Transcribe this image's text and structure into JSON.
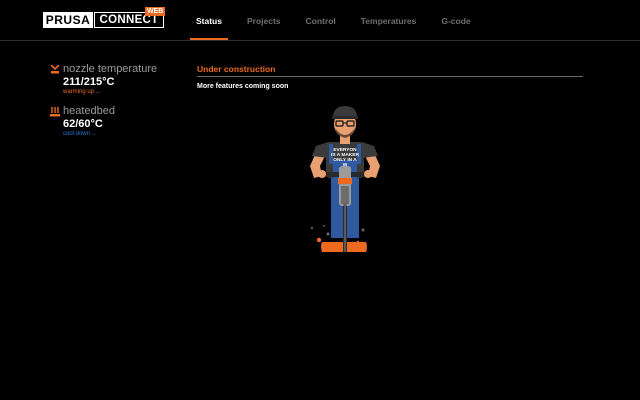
{
  "header": {
    "logo": {
      "brand": "PRUSA",
      "product": "CONNECT",
      "badge": "WEB"
    },
    "tabs": [
      {
        "label": "Status",
        "active": true
      },
      {
        "label": "Projects",
        "active": false
      },
      {
        "label": "Control",
        "active": false
      },
      {
        "label": "Temperatures",
        "active": false
      },
      {
        "label": "G-code",
        "active": false
      }
    ]
  },
  "sidebar": {
    "nozzle": {
      "name": "nozzle temperature",
      "value": "211/215°C",
      "status": "warming up ..."
    },
    "bed": {
      "name": "heatedbed",
      "value": "62/60°C",
      "status": "cool down ..."
    }
  },
  "main": {
    "title": "Under construction",
    "subtitle": "More features coming soon",
    "shirt_text": [
      "EVERYON",
      "IS A MAKER",
      "ONLY IN A",
      "W"
    ]
  },
  "colors": {
    "accent": "#ed6b21",
    "cool": "#1e7fd6",
    "background": "#000000"
  }
}
